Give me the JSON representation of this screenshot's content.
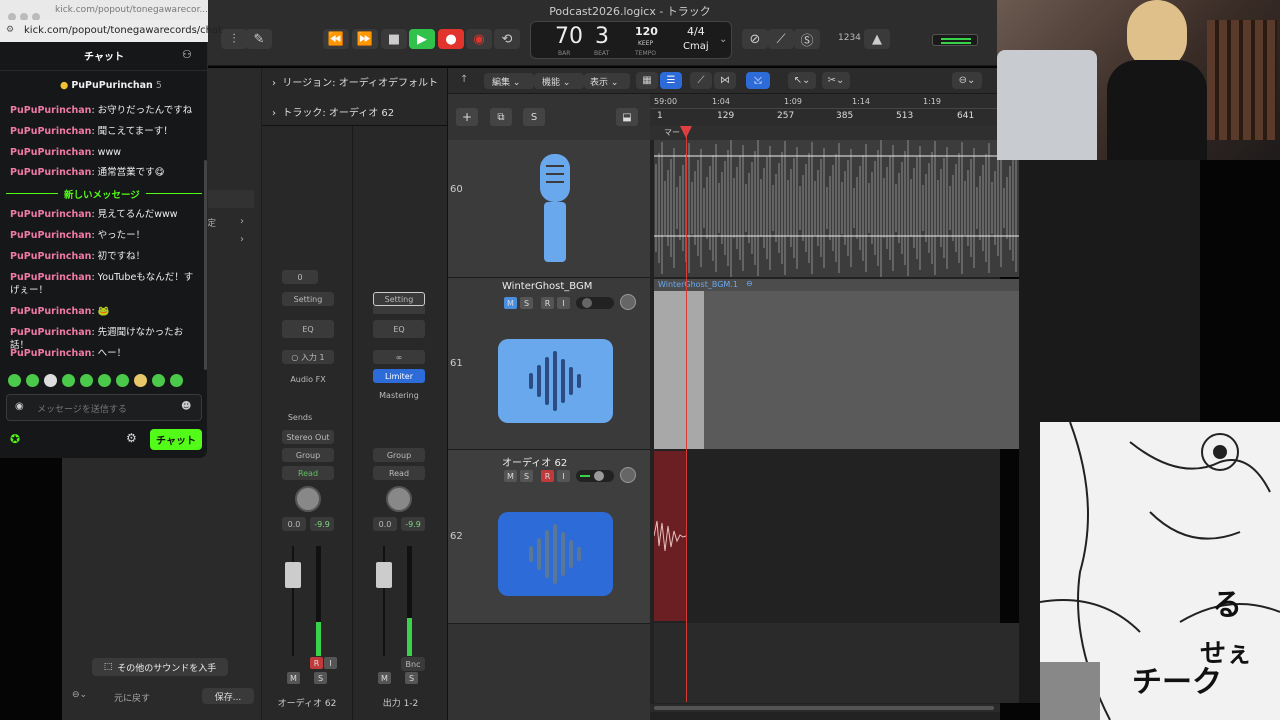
{
  "chat": {
    "url_top": "kick.com/popout/tonegawarecor...",
    "url": "kick.com/popout/tonegawarecords/chat",
    "title": "チャット",
    "pinned_user": "PuPuPurinchan",
    "pinned_count": "5",
    "new_messages_divider": "新しいメッセージ",
    "messages": [
      {
        "user": "PuPuPurinchan",
        "text": ": お守りだったんですね"
      },
      {
        "user": "PuPuPurinchan",
        "text": ": 聞こえてまーす！"
      },
      {
        "user": "PuPuPurinchan",
        "text": ": www"
      },
      {
        "user": "PuPuPurinchan",
        "text": ": 通常営業です😋"
      },
      {
        "user": "PuPuPurinchan",
        "text": ": 見えてるんだwww"
      },
      {
        "user": "PuPuPurinchan",
        "text": ": やったー！"
      },
      {
        "user": "PuPuPurinchan",
        "text": ": 初ですね！"
      },
      {
        "user": "PuPuPurinchan",
        "text": ": YouTubeもなんだ！すげぇー！"
      },
      {
        "user": "PuPuPurinchan",
        "text": ": 🐸"
      },
      {
        "user": "PuPuPurinchan",
        "text": ": 先週聞けなかったお話！"
      },
      {
        "user": "PuPuPurinchan",
        "text": ": へー！"
      }
    ],
    "input_placeholder": "メッセージを送信する",
    "send_label": "チャット"
  },
  "window": {
    "title": "Podcast2026.logicx - トラック"
  },
  "lcd": {
    "bar": "70",
    "beat": "3",
    "bar_label": "BAR",
    "beat_label": "BEAT",
    "tempo": "120",
    "keep": "KEEP",
    "tempo_label": "TEMPO",
    "signature": "4/4",
    "key": "Cmaj"
  },
  "toolbar_right": {
    "count_in": "1234"
  },
  "library": {
    "partial_label": "定",
    "get_sounds": "その他のサウンドを入手",
    "revert": "元に戻す",
    "save": "保存..."
  },
  "inspector": {
    "region_label": "リージョン: オーディオデフォルト",
    "track_label": "トラック: オーディオ 62",
    "gain_value": "0",
    "strip1": {
      "setting": "Setting",
      "eq": "EQ",
      "input": "入力 1",
      "audio_fx": "Audio FX",
      "sends": "Sends",
      "output": "Stereo Out",
      "group": "Group",
      "automation": "Read",
      "pan": "0.0",
      "db": "-9.9",
      "name": "オーディオ 62",
      "m": "M",
      "s": "S",
      "r": "R",
      "i": "I"
    },
    "strip2": {
      "setting": "Setting",
      "eq": "EQ",
      "link": "∞",
      "limiter": "Limiter",
      "mastering": "Mastering",
      "group": "Group",
      "automation": "Read",
      "pan": "0.0",
      "db": "-9.9",
      "bnc": "Bnc",
      "name": "出力 1-2",
      "m": "M",
      "s": "S"
    }
  },
  "tracks_toolbar": {
    "edit": "編集",
    "functions": "機能",
    "view": "表示"
  },
  "ruler": {
    "times": [
      "59:00",
      "1:04",
      "1:09",
      "1:14",
      "1:19"
    ],
    "bars": [
      "1",
      "129",
      "257",
      "385",
      "513",
      "641"
    ],
    "marker": "マー"
  },
  "tracks": [
    {
      "number": "60",
      "name": ""
    },
    {
      "number": "61",
      "name": "WinterGhost_BGM",
      "region": "WinterGhost_BGM.1"
    },
    {
      "number": "62",
      "name": "オーディオ 62"
    }
  ],
  "manga_text": "るせぇチーク",
  "colors": {
    "accent": "#4a90e2",
    "record": "#e0342c",
    "play": "#30c24b",
    "kick_green": "#53fc18"
  }
}
